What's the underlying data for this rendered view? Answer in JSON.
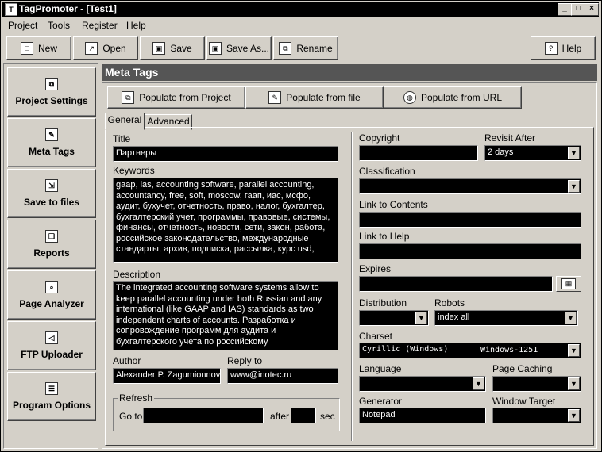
{
  "window": {
    "title": "TagPromoter - [Test1]"
  },
  "menu": [
    "Project",
    "Tools",
    "Register",
    "Help"
  ],
  "toolbar": {
    "new": "New",
    "open": "Open",
    "save": "Save",
    "save_as": "Save As...",
    "rename": "Rename",
    "help": "Help"
  },
  "sidebar": {
    "items": [
      "Project Settings",
      "Meta Tags",
      "Save to files",
      "Reports",
      "Page Analyzer",
      "FTP Uploader",
      "Program Options"
    ]
  },
  "panel": {
    "title": "Meta Tags"
  },
  "populate": {
    "project": "Populate from Project",
    "file": "Populate from file",
    "url": "Populate from URL"
  },
  "tabs": {
    "general": "General",
    "advanced": "Advanced"
  },
  "form": {
    "title_label": "Title",
    "title_value": "Партнеры",
    "keywords_label": "Keywords",
    "keywords_value": "gaap, ias, accounting software, parallel accounting, accountancy, free, soft, moscow, гаап, иас, мсфо, аудит, бухучет, отчетность, право, налог, бухгалтер, бухгалтерский учет, программы, правовые, системы, финансы, отчетность, новости, сети, закон, работа, российское законодательство, международные стандарты, архив, подписка, рассылка, курс usd,",
    "description_label": "Description",
    "description_value": "The integrated accounting software systems allow to keep parallel accounting under both Russian and any international (like GAAP and IAS) standards as two independent charts of accounts. Разработка и сопровождение программ для аудита и бухгалтерского учета по российскому",
    "author_label": "Author",
    "author_value": "Alexander P. Zagumionnov",
    "reply_label": "Reply to",
    "reply_value": "www@inotec.ru",
    "refresh_label": "Refresh",
    "goto_label": "Go to",
    "goto_value": "",
    "after_label": "after",
    "after_value": "",
    "sec_label": "sec",
    "copyright_label": "Copyright",
    "copyright_value": "",
    "revisit_label": "Revisit After",
    "revisit_value": "2 days",
    "classification_label": "Classification",
    "classification_value": "",
    "contents_label": "Link to Contents",
    "contents_value": "",
    "help_link_label": "Link to Help",
    "help_link_value": "",
    "expires_label": "Expires",
    "expires_value": "",
    "distribution_label": "Distribution",
    "distribution_value": "",
    "robots_label": "Robots",
    "robots_value": "index all",
    "charset_label": "Charset",
    "charset_name": "Cyrillic (Windows)",
    "charset_code": "Windows-1251",
    "language_label": "Language",
    "language_value": "",
    "caching_label": "Page Caching",
    "caching_value": "",
    "generator_label": "Generator",
    "generator_value": "Notepad",
    "target_label": "Window Target",
    "target_value": ""
  }
}
